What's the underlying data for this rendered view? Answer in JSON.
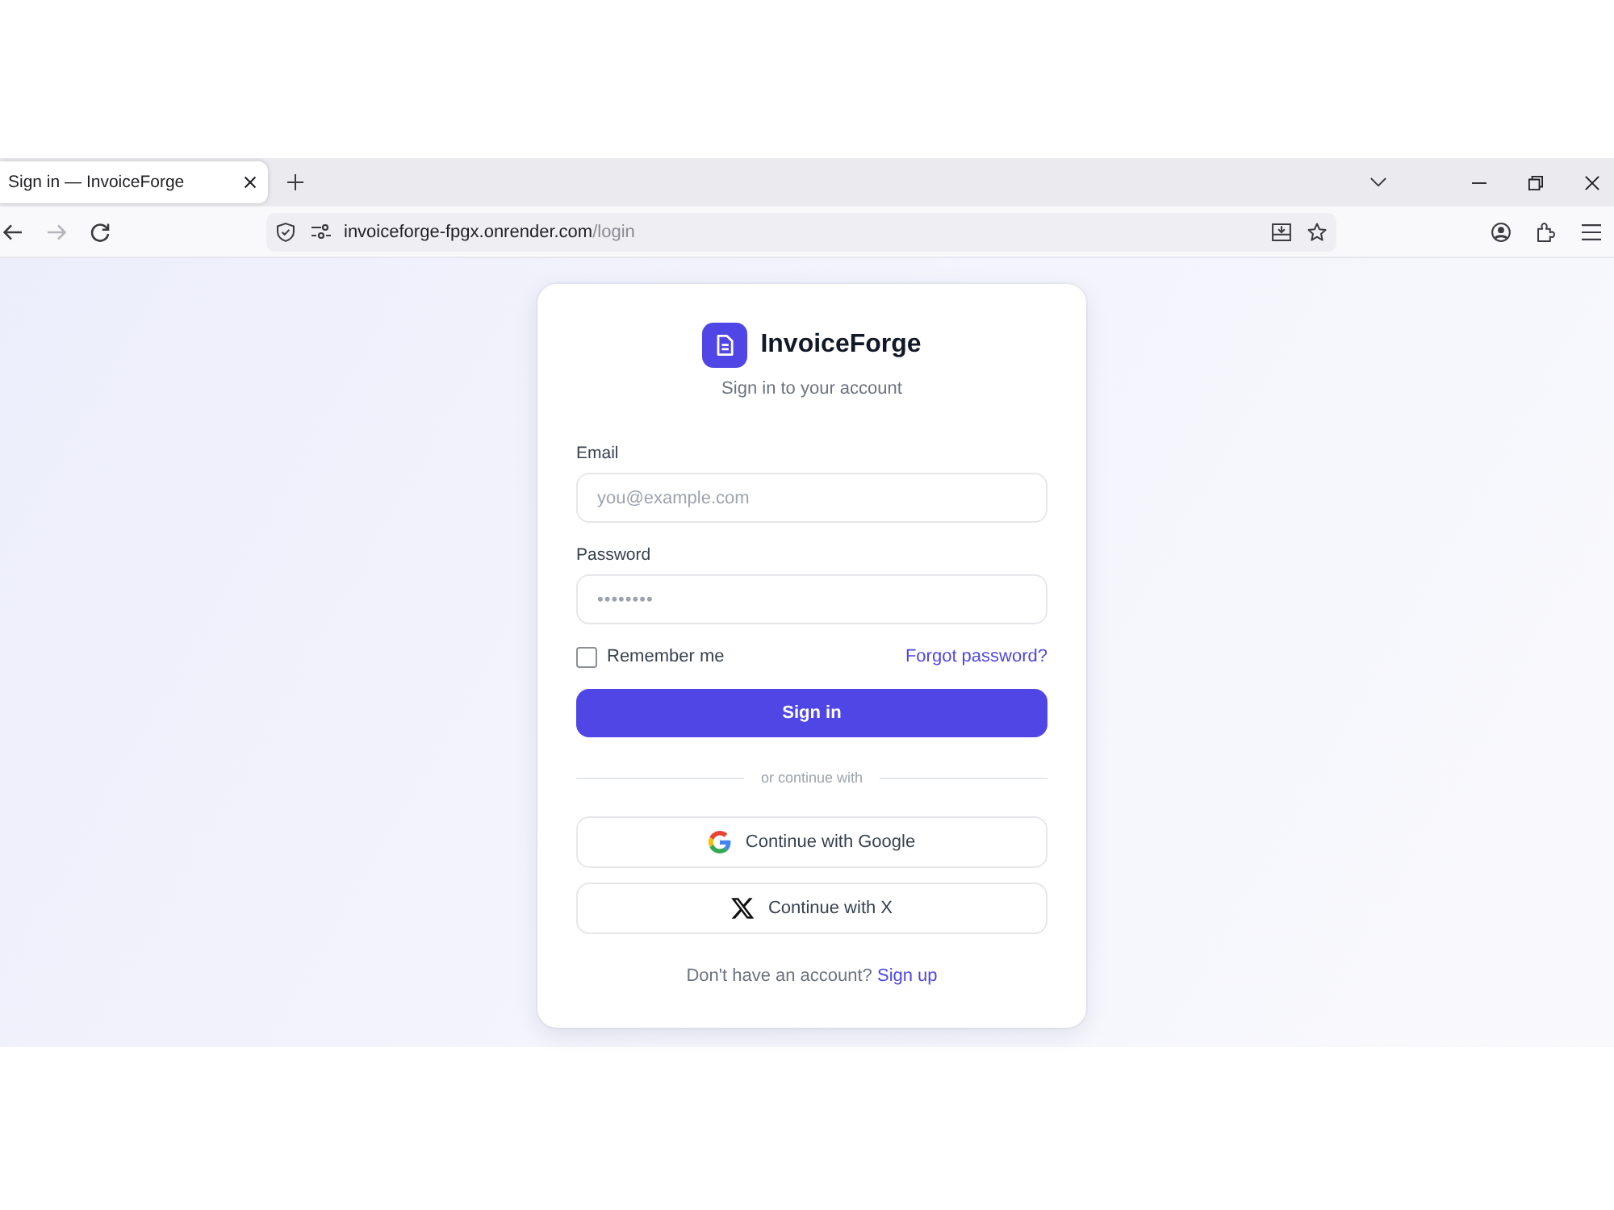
{
  "browser": {
    "tabs": [
      {
        "title": "Sign in — InvoiceForge",
        "selected": true
      }
    ],
    "nav": [
      {
        "kind": "back",
        "disabled": false
      },
      {
        "kind": "forward",
        "disabled": true
      },
      {
        "kind": "reload",
        "disabled": false
      }
    ],
    "url": {
      "host": "invoiceforge-fpgx.onrender.com",
      "path": "/login"
    }
  },
  "brand": {
    "name": "InvoiceForge",
    "subtitle": "Sign in to your account"
  },
  "form": {
    "fields": [
      {
        "kind": "email",
        "label": "Email",
        "placeholder": "you@example.com"
      },
      {
        "kind": "password",
        "label": "Password",
        "placeholder": "••••••••"
      }
    ],
    "remember": {
      "label": "Remember me",
      "checked": false
    },
    "forgot_link": "Forgot password?",
    "submit": "Sign in"
  },
  "divider": "or continue with",
  "social": [
    {
      "kind": "google",
      "label": "Continue with Google"
    },
    {
      "kind": "x",
      "label": "Continue with X"
    }
  ],
  "footer": {
    "prompt": "Don't have an account?",
    "link": "Sign up"
  }
}
